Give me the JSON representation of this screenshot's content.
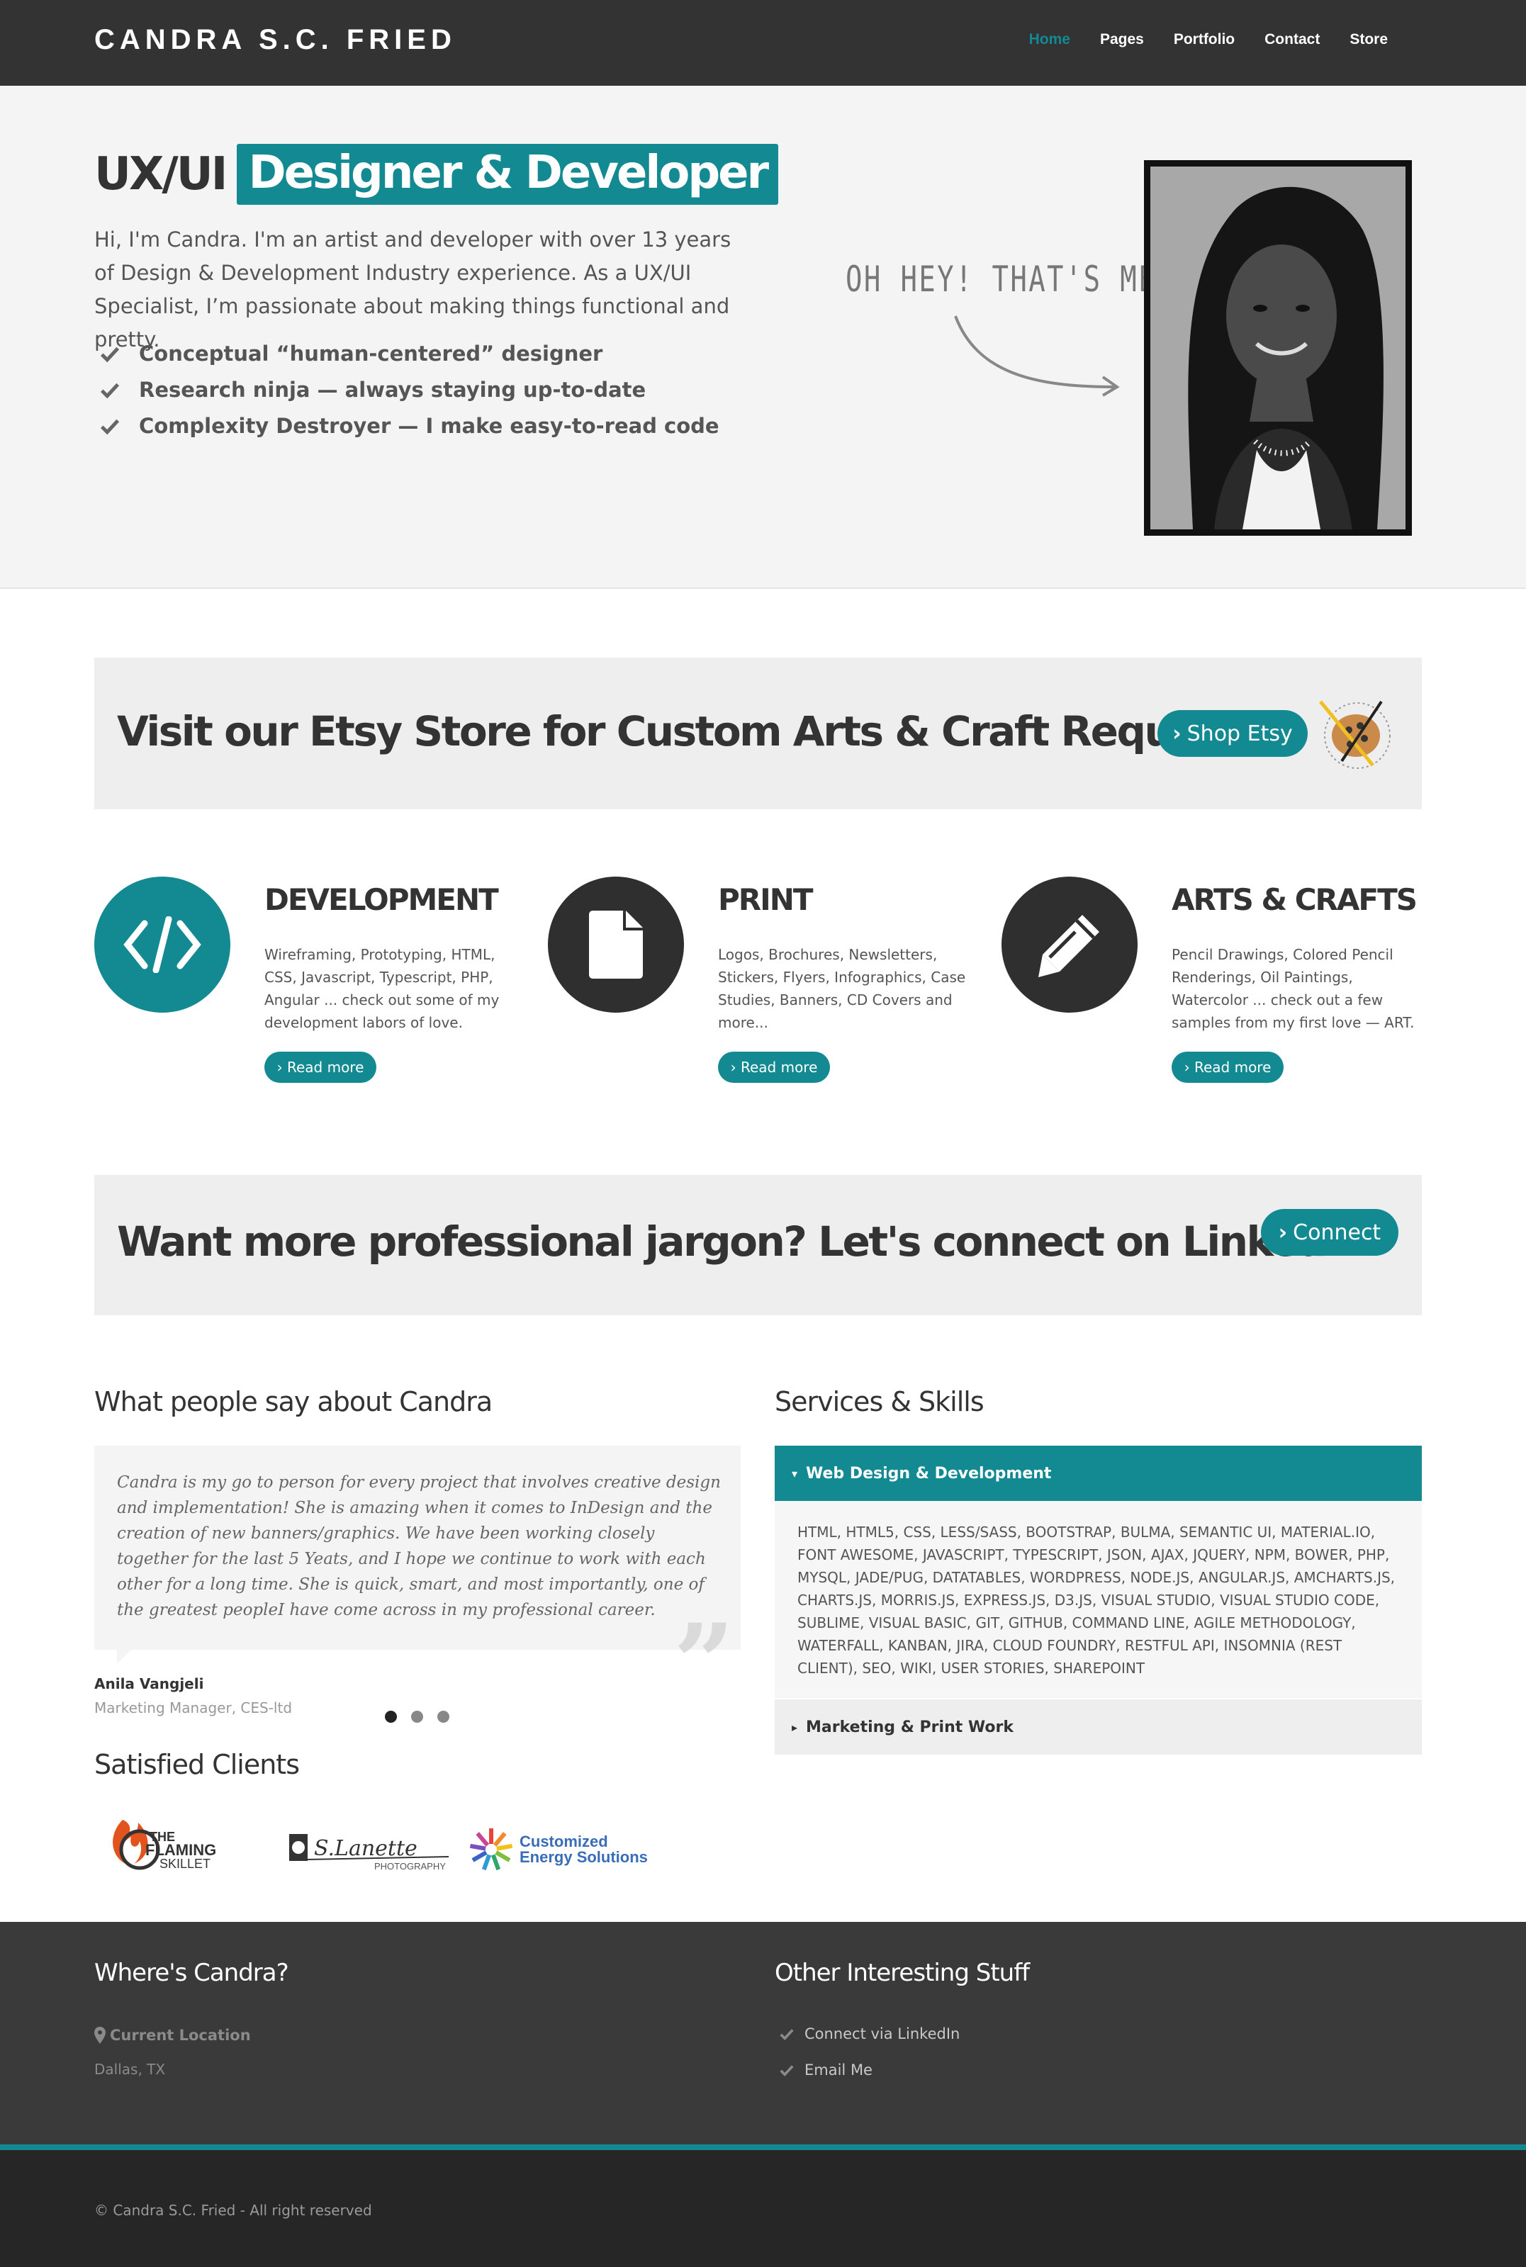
{
  "header": {
    "brand": "CANDRA S.C. FRIED",
    "nav": [
      "Home",
      "Pages",
      "Portfolio",
      "Contact",
      "Store"
    ],
    "active_nav": "Home"
  },
  "hero": {
    "title_plain": "UX/UI",
    "title_highlight": "Designer & Developer",
    "intro": "Hi, I'm Candra. I'm an artist and developer with over 13 years of Design & Development Industry experience. As a UX/UI Specialist, I’m passionate about making things functional and pretty.",
    "checklist": [
      "Conceptual “human-centered” designer",
      "Research ninja — always staying up-to-date",
      "Complexity Destroyer — I make easy-to-read code"
    ],
    "callout": "OH HEY! THAT'S ME!"
  },
  "etsy_banner": {
    "heading": "Visit our Etsy Store for Custom Arts & Craft Requests",
    "button": "Shop Etsy"
  },
  "services": [
    {
      "title": "DEVELOPMENT",
      "text": "Wireframing, Prototyping, HTML, CSS, Javascript, Typescript, PHP, Angular ... check out some of my development labors of love.",
      "button": "Read more",
      "icon": "code-icon"
    },
    {
      "title": "PRINT",
      "text": "Logos, Brochures, Newsletters, Stickers, Flyers, Infographics, Case Studies, Banners, CD Covers and more...",
      "button": "Read more",
      "icon": "file-icon"
    },
    {
      "title": "ARTS & CRAFTS",
      "text": "Pencil Drawings, Colored Pencil Renderings, Oil Paintings, Watercolor ... check out a few samples from my first love — ART.",
      "button": "Read more",
      "icon": "pencil-icon"
    }
  ],
  "linkedin_banner": {
    "heading": "Want more professional jargon? Let's connect on LinkedIn.",
    "button": "Connect"
  },
  "testimonials": {
    "heading": "What people say about Candra",
    "quote": "Candra is my go to person for every project that involves creative design and implementation! She is amazing when it comes to InDesign and the creation of new banners/graphics. We have been working closely together for the last 5 Yeats, and I hope we continue to work with each other for a long time. She is quick, smart, and most importantly, one of the greatest peopleI have come across in my professional career.",
    "author": "Anila Vangjeli",
    "role": "Marketing Manager, CES-ltd",
    "slide_count": 3,
    "active_slide": 1
  },
  "clients": {
    "heading": "Satisfied Clients",
    "logos": [
      {
        "line1": "THE",
        "line2": "FLAMING",
        "line3": "SKILLET"
      },
      {
        "line1": "S.Lanette",
        "line2": "PHOTOGRAPHY"
      },
      {
        "line1": "Customized",
        "line2": "Energy Solutions"
      }
    ]
  },
  "skills": {
    "heading": "Services & Skills",
    "open_panel": "Web Design & Development",
    "open_content": "HTML, HTML5, CSS, LESS/SASS, BOOTSTRAP, BULMA, SEMANTIC UI, MATERIAL.IO, FONT AWESOME, JAVASCRIPT, TYPESCRIPT, JSON, AJAX, JQUERY, NPM, BOWER, PHP, MYSQL, JADE/PUG, DATATABLES, WORDPRESS, NODE.JS, ANGULAR.JS, AMCHARTS.JS, CHARTS.JS, MORRIS.JS, EXPRESS.JS, D3.JS, VISUAL STUDIO, VISUAL STUDIO CODE, SUBLIME, VISUAL BASIC, GIT, GITHUB, COMMAND LINE, AGILE METHODOLOGY, WATERFALL, KANBAN, JIRA, CLOUD FOUNDRY, RESTFUL API, INSOMNIA (REST CLIENT), SEO, WIKI, USER STORIES, SHAREPOINT",
    "closed_panel": "Marketing & Print Work"
  },
  "footer": {
    "left_heading": "Where's Candra?",
    "location_label": "Current Location",
    "location_value": "Dallas, TX",
    "right_heading": "Other Interesting Stuff",
    "links": [
      "Connect via LinkedIn",
      "Email Me"
    ],
    "copyright": "© Candra S.C. Fried - All right reserved"
  },
  "colors": {
    "accent": "#138a92",
    "navbar": "#333333",
    "footer": "#3a3a3a",
    "bottombar": "#262626"
  }
}
